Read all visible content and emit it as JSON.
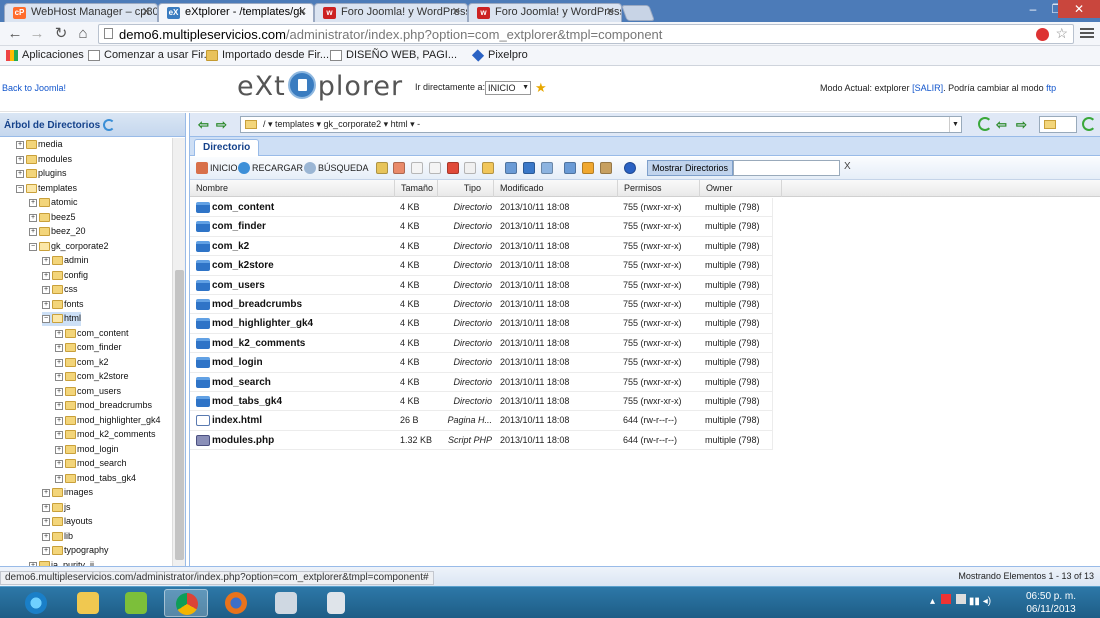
{
  "browser": {
    "tabs": [
      {
        "label": "WebHost Manager – cp80",
        "favicon": "cP",
        "favicon_color": "#ff6c2c"
      },
      {
        "label": "eXtplorer - /templates/gk",
        "favicon": "eX",
        "favicon_color": "#3a7cc0"
      },
      {
        "label": "Foro Joomla! y WordPress",
        "favicon": "w",
        "favicon_color": "#c22"
      },
      {
        "label": "Foro Joomla! y WordPress",
        "favicon": "w",
        "favicon_color": "#c22"
      }
    ],
    "url_host": "demo6.multipleservicios.com",
    "url_path": "/administrator/index.php?option=com_extplorer&tmpl=component",
    "bookmarks": [
      "Aplicaciones",
      "Comenzar a usar Fir...",
      "Importado desde Fir...",
      "DISEÑO WEB, PAGI...",
      "Pixelpro"
    ],
    "status_url": "demo6.multipleservicios.com/administrator/index.php?option=com_extplorer&tmpl=component#"
  },
  "header": {
    "back_link": "Back to Joomla!",
    "logo_left": "eXt",
    "logo_right": "plorer",
    "goto_label": "Ir directamente a:",
    "goto_value": "INICIO",
    "mode_prefix": "Modo Actual: extplorer",
    "mode_logout": "[SALIR]",
    "mode_middle": ". Podría cambiar al modo",
    "mode_link": "ftp"
  },
  "tree": {
    "title": "Árbol de Directorios",
    "nodes": [
      {
        "label": "media",
        "depth": 1
      },
      {
        "label": "modules",
        "depth": 1
      },
      {
        "label": "plugins",
        "depth": 1
      },
      {
        "label": "templates",
        "depth": 1,
        "open": true
      },
      {
        "label": "atomic",
        "depth": 2
      },
      {
        "label": "beez5",
        "depth": 2
      },
      {
        "label": "beez_20",
        "depth": 2
      },
      {
        "label": "gk_corporate2",
        "depth": 2,
        "open": true
      },
      {
        "label": "admin",
        "depth": 3
      },
      {
        "label": "config",
        "depth": 3
      },
      {
        "label": "css",
        "depth": 3
      },
      {
        "label": "fonts",
        "depth": 3
      },
      {
        "label": "html",
        "depth": 3,
        "open": true,
        "selected": true
      },
      {
        "label": "com_content",
        "depth": 4
      },
      {
        "label": "com_finder",
        "depth": 4
      },
      {
        "label": "com_k2",
        "depth": 4
      },
      {
        "label": "com_k2store",
        "depth": 4
      },
      {
        "label": "com_users",
        "depth": 4
      },
      {
        "label": "mod_breadcrumbs",
        "depth": 4
      },
      {
        "label": "mod_highlighter_gk4",
        "depth": 4
      },
      {
        "label": "mod_k2_comments",
        "depth": 4
      },
      {
        "label": "mod_login",
        "depth": 4
      },
      {
        "label": "mod_search",
        "depth": 4
      },
      {
        "label": "mod_tabs_gk4",
        "depth": 4
      },
      {
        "label": "images",
        "depth": 3
      },
      {
        "label": "js",
        "depth": 3
      },
      {
        "label": "layouts",
        "depth": 3
      },
      {
        "label": "lib",
        "depth": 3
      },
      {
        "label": "typography",
        "depth": 3
      },
      {
        "label": "ja_purity_ii",
        "depth": 2
      }
    ]
  },
  "path": {
    "crumbs": "/ ▾  templates ▾  gk_corporate2 ▾  html ▾ -"
  },
  "panel": {
    "tab_label": "Directorio",
    "home_label": "INICIO",
    "reload_label": "RECARGAR",
    "search_label": "BÚSQUEDA",
    "show_dirs_label": "Mostrar Directorios",
    "filter_clear": "X"
  },
  "grid": {
    "columns": [
      "Nombre",
      "Tamaño",
      "Tipo",
      "Modificado",
      "Permisos",
      "Owner"
    ],
    "rows": [
      {
        "name": "com_content",
        "size": "4 KB",
        "type": "Directorio",
        "modified": "2013/10/11 18:08",
        "perms": "755 (rwxr-xr-x)",
        "owner": "multiple (798)",
        "kind": "dir"
      },
      {
        "name": "com_finder",
        "size": "4 KB",
        "type": "Directorio",
        "modified": "2013/10/11 18:08",
        "perms": "755 (rwxr-xr-x)",
        "owner": "multiple (798)",
        "kind": "dir"
      },
      {
        "name": "com_k2",
        "size": "4 KB",
        "type": "Directorio",
        "modified": "2013/10/11 18:08",
        "perms": "755 (rwxr-xr-x)",
        "owner": "multiple (798)",
        "kind": "dir"
      },
      {
        "name": "com_k2store",
        "size": "4 KB",
        "type": "Directorio",
        "modified": "2013/10/11 18:08",
        "perms": "755 (rwxr-xr-x)",
        "owner": "multiple (798)",
        "kind": "dir"
      },
      {
        "name": "com_users",
        "size": "4 KB",
        "type": "Directorio",
        "modified": "2013/10/11 18:08",
        "perms": "755 (rwxr-xr-x)",
        "owner": "multiple (798)",
        "kind": "dir"
      },
      {
        "name": "mod_breadcrumbs",
        "size": "4 KB",
        "type": "Directorio",
        "modified": "2013/10/11 18:08",
        "perms": "755 (rwxr-xr-x)",
        "owner": "multiple (798)",
        "kind": "dir"
      },
      {
        "name": "mod_highlighter_gk4",
        "size": "4 KB",
        "type": "Directorio",
        "modified": "2013/10/11 18:08",
        "perms": "755 (rwxr-xr-x)",
        "owner": "multiple (798)",
        "kind": "dir"
      },
      {
        "name": "mod_k2_comments",
        "size": "4 KB",
        "type": "Directorio",
        "modified": "2013/10/11 18:08",
        "perms": "755 (rwxr-xr-x)",
        "owner": "multiple (798)",
        "kind": "dir"
      },
      {
        "name": "mod_login",
        "size": "4 KB",
        "type": "Directorio",
        "modified": "2013/10/11 18:08",
        "perms": "755 (rwxr-xr-x)",
        "owner": "multiple (798)",
        "kind": "dir"
      },
      {
        "name": "mod_search",
        "size": "4 KB",
        "type": "Directorio",
        "modified": "2013/10/11 18:08",
        "perms": "755 (rwxr-xr-x)",
        "owner": "multiple (798)",
        "kind": "dir"
      },
      {
        "name": "mod_tabs_gk4",
        "size": "4 KB",
        "type": "Directorio",
        "modified": "2013/10/11 18:08",
        "perms": "755 (rwxr-xr-x)",
        "owner": "multiple (798)",
        "kind": "dir"
      },
      {
        "name": "index.html",
        "size": "26 B",
        "type": "Pagina H...",
        "modified": "2013/10/11 18:08",
        "perms": "644 (rw-r--r--)",
        "owner": "multiple (798)",
        "kind": "html"
      },
      {
        "name": "modules.php",
        "size": "1.32 KB",
        "type": "Script PHP",
        "modified": "2013/10/11 18:08",
        "perms": "644 (rw-r--r--)",
        "owner": "multiple (798)",
        "kind": "php"
      }
    ],
    "count_text": "Mostrando Elementos 1 - 13 of 13"
  },
  "taskbar": {
    "apps": [
      "ie-icon",
      "explorer-icon",
      "wordpad-icon",
      "chrome-icon",
      "firefox-icon",
      "network-icon",
      "calculator-icon"
    ],
    "time": "06:50 p. m.",
    "date": "06/11/2013"
  }
}
